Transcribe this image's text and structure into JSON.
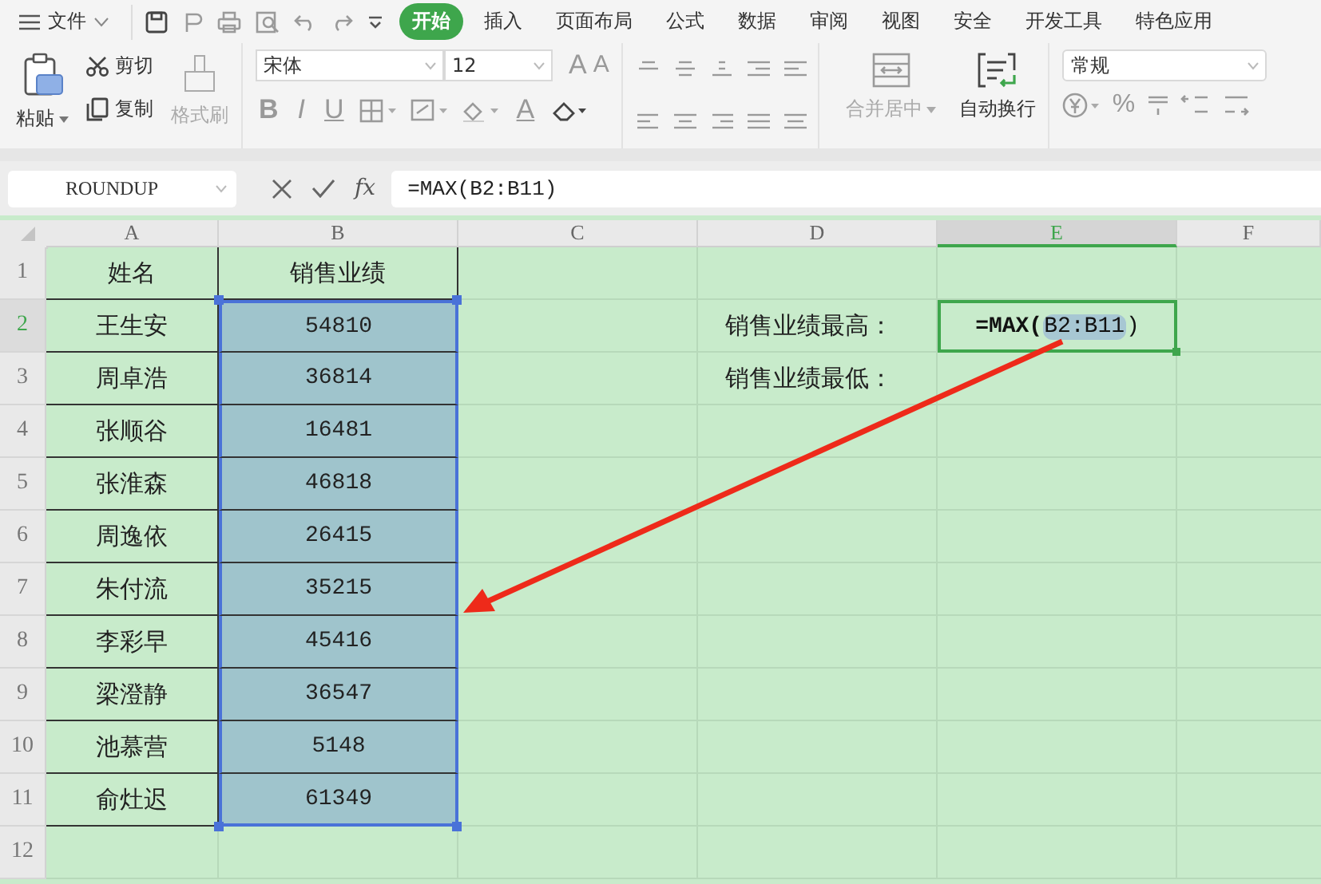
{
  "menu": {
    "file": "文件",
    "tabs": [
      {
        "label": "开始",
        "selected": true
      },
      {
        "label": "插入",
        "selected": false
      },
      {
        "label": "页面布局",
        "selected": false
      },
      {
        "label": "公式",
        "selected": false
      },
      {
        "label": "数据",
        "selected": false
      },
      {
        "label": "审阅",
        "selected": false
      },
      {
        "label": "视图",
        "selected": false
      },
      {
        "label": "安全",
        "selected": false
      },
      {
        "label": "开发工具",
        "selected": false
      },
      {
        "label": "特色应用",
        "selected": false
      }
    ]
  },
  "toolbar": {
    "paste": "粘贴",
    "cut": "剪切",
    "copy": "复制",
    "format_painter": {
      "label": "格式刷",
      "disabled": true
    },
    "font_name": "宋体",
    "font_size": "12",
    "grow": "A",
    "shrink": "A",
    "bold": "B",
    "italic": "I",
    "underline": "U",
    "font_color": "A",
    "merge": {
      "label": "合并居中",
      "disabled": true
    },
    "wrap": {
      "label": "自动换行",
      "disabled": false
    },
    "number_format": "常规",
    "percent": "%"
  },
  "formula_bar": {
    "name_box": "ROUNDUP",
    "fx": "fx",
    "formula": "=MAX(B2:B11)"
  },
  "columns": [
    {
      "label": "A",
      "selected": false
    },
    {
      "label": "B",
      "selected": false
    },
    {
      "label": "C",
      "selected": false
    },
    {
      "label": "D",
      "selected": false
    },
    {
      "label": "E",
      "selected": true
    },
    {
      "label": "F",
      "selected": false
    }
  ],
  "rows": [
    {
      "number": "1",
      "selected": false,
      "a": "姓名",
      "b": "销售业绩",
      "b_selected": false
    },
    {
      "number": "2",
      "selected": true,
      "a": "王生安",
      "b": "54810",
      "b_selected": true,
      "d": "销售业绩最高：",
      "e": {
        "prefix": "=MAX(",
        "ref": "B2:B11",
        "suffix": ")",
        "active": true
      }
    },
    {
      "number": "3",
      "selected": false,
      "a": "周卓浩",
      "b": "36814",
      "b_selected": true,
      "d": "销售业绩最低："
    },
    {
      "number": "4",
      "selected": false,
      "a": "张顺谷",
      "b": "16481",
      "b_selected": true
    },
    {
      "number": "5",
      "selected": false,
      "a": "张淮森",
      "b": "46818",
      "b_selected": true
    },
    {
      "number": "6",
      "selected": false,
      "a": "周逸依",
      "b": "26415",
      "b_selected": true
    },
    {
      "number": "7",
      "selected": false,
      "a": "朱付流",
      "b": "35215",
      "b_selected": true
    },
    {
      "number": "8",
      "selected": false,
      "a": "李彩早",
      "b": "45416",
      "b_selected": true
    },
    {
      "number": "9",
      "selected": false,
      "a": "梁澄静",
      "b": "36547",
      "b_selected": true
    },
    {
      "number": "10",
      "selected": false,
      "a": "池慕营",
      "b": "5148",
      "b_selected": true
    },
    {
      "number": "11",
      "selected": false,
      "a": "俞灶迟",
      "b": "61349",
      "b_selected": true
    },
    {
      "number": "12",
      "selected": false
    }
  ]
}
